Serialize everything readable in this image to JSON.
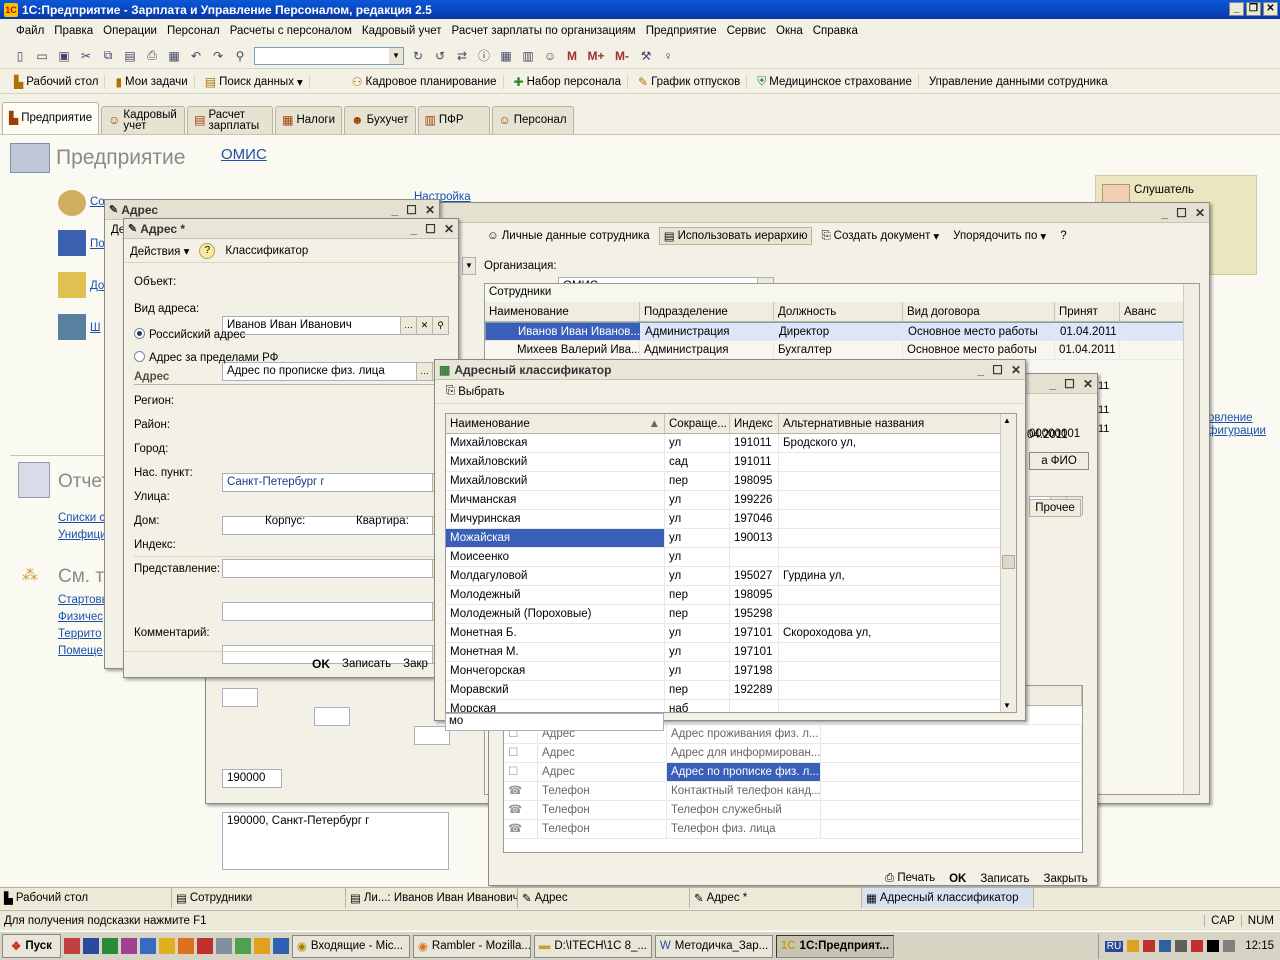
{
  "app": {
    "title": "1С:Предприятие - Зарплата и Управление Персоналом, редакция 2.5"
  },
  "menu": [
    "Файл",
    "Правка",
    "Операции",
    "Персонал",
    "Расчеты с персоналом",
    "Кадровый учет",
    "Расчет зарплаты по организациям",
    "Предприятие",
    "Сервис",
    "Окна",
    "Справка"
  ],
  "quickbar": [
    "Рабочий стол",
    "Мои задачи",
    "Поиск данных",
    "Кадровое планирование",
    "Набор персонала",
    "График отпусков",
    "Медицинское страхование",
    "Управление данными сотрудника"
  ],
  "sectiontabs": [
    "Предприятие",
    "Кадровый учет",
    "Расчет зарплаты",
    "Налоги",
    "Бухучет",
    "ПФР",
    "Персонал"
  ],
  "desktop": {
    "title": "Предприятие",
    "org_link": "ОМИС",
    "nastroyka": "Настройка",
    "reports_title": "Отчеты",
    "see_also": "См. также",
    "links_left1": [
      "Списки с",
      "Унифици"
    ],
    "links_left2": [
      "Стартовы",
      "Физичес",
      "Террито",
      "Помеще"
    ],
    "side_labels": [
      "Со",
      "По",
      "До",
      "Ш"
    ],
    "listener": "Слушатель",
    "right_links": [
      "овление",
      "фигурации"
    ]
  },
  "employees": {
    "toolbar": [
      "Личные данные сотрудника",
      "Использовать иерархию",
      "Создать документ",
      "Упорядочить по"
    ],
    "org_label": "Организация:",
    "org_value": "ОМИС",
    "group_title": "Сотрудники",
    "columns": [
      "Наименование",
      "Подразделение",
      "Должность",
      "Вид договора",
      "Принят",
      "Аванс"
    ],
    "rows": [
      [
        "Иванов Иван Иванов...",
        "Администрация",
        "Директор",
        "Основное место работы",
        "01.04.2011",
        ""
      ],
      [
        "Михеев Валерий Ива...",
        "Администрация",
        "Бухгалтер",
        "Основное место работы",
        "01.04.2011",
        ""
      ]
    ],
    "partial_dates": [
      "12.04.2011"
    ],
    "partial_right": [
      "11",
      "11",
      "11"
    ]
  },
  "person": {
    "code": "00000001",
    "fio_btn": "а ФИО",
    "tab": "Прочее",
    "contacts": [
      [
        "Адрес",
        "Адрес проживания физ. л..."
      ],
      [
        "Адрес",
        "Адрес для информирован..."
      ],
      [
        "Адрес",
        "Адрес по прописке физ. л..."
      ],
      [
        "Телефон",
        "Контактный телефон канд..."
      ],
      [
        "Телефон",
        "Телефон служебный"
      ],
      [
        "Телефон",
        "Телефон физ. лица"
      ]
    ],
    "footer": [
      "Печать",
      "OK",
      "Записать",
      "Закрыть"
    ]
  },
  "address_back": {
    "title": "Адрес",
    "menu": "Де"
  },
  "address": {
    "title": "Адрес *",
    "menu_actions": "Действия",
    "menu_help": "?",
    "menu_class": "Классификатор",
    "object_label": "Объект:",
    "object_value": "Иванов Иван Иванович",
    "type_label": "Вид адреса:",
    "type_value": "Адрес по прописке физ. лица",
    "radio_ru": "Российский адрес",
    "radio_foreign": "Адрес за пределами РФ",
    "section": "Адрес",
    "region_label": "Регион:",
    "region_value": "Санкт-Петербург г",
    "district_label": "Район:",
    "city_label": "Город:",
    "settlement_label": "Нас. пункт:",
    "street_label": "Улица:",
    "house_label": "Дом:",
    "korpus_label": "Корпус:",
    "flat_label": "Квартира:",
    "index_label": "Индекс:",
    "index_value": "190000",
    "repr_label": "Представление:",
    "repr_value": "190000, Санкт-Петербург г",
    "comment_label": "Комментарий:",
    "footer": [
      "OK",
      "Записать",
      "Закр"
    ]
  },
  "classifier": {
    "title": "Адресный классификатор",
    "select_btn": "Выбрать",
    "columns": [
      "Наименование",
      "Сокраще...",
      "Индекс",
      "Альтернативные названия"
    ],
    "rows": [
      [
        "Михайловская",
        "ул",
        "191011",
        "Бродского ул,"
      ],
      [
        "Михайловский",
        "сад",
        "191011",
        ""
      ],
      [
        "Михайловский",
        "пер",
        "198095",
        ""
      ],
      [
        "Мичманская",
        "ул",
        "199226",
        ""
      ],
      [
        "Мичуринская",
        "ул",
        "197046",
        ""
      ],
      [
        "Можайская",
        "ул",
        "190013",
        ""
      ],
      [
        "Моисеенко",
        "ул",
        "",
        ""
      ],
      [
        "Молдагуловой",
        "ул",
        "195027",
        "Гурдина ул,"
      ],
      [
        "Молодежный",
        "пер",
        "198095",
        ""
      ],
      [
        "Молодежный (Пороховые)",
        "пер",
        "195298",
        ""
      ],
      [
        "Монетная Б.",
        "ул",
        "197101",
        "Скороходова ул,"
      ],
      [
        "Монетная М.",
        "ул",
        "197101",
        ""
      ],
      [
        "Мончегорская",
        "ул",
        "197198",
        ""
      ],
      [
        "Моравский",
        "пер",
        "192289",
        ""
      ],
      [
        "Морская",
        "наб",
        "",
        ""
      ]
    ],
    "selected_index": 5,
    "search_value": "мо"
  },
  "taskbar_1c": [
    "Рабочий стол",
    "Сотрудники",
    "Ли...: Иванов Иван Иванович",
    "Адрес",
    "Адрес *",
    "Адресный классификатор"
  ],
  "status": {
    "hint": "Для получения подсказки нажмите F1",
    "caps": "CAP",
    "num": "NUM"
  },
  "windows_taskbar": {
    "start": "Пуск",
    "tasks": [
      "Входящие - Mic...",
      "Rambler - Mozilla...",
      "D:\\ITECH\\1C 8_...",
      "Методичка_Зар...",
      "1С:Предприят..."
    ],
    "lang": "RU",
    "time": "12:15"
  }
}
